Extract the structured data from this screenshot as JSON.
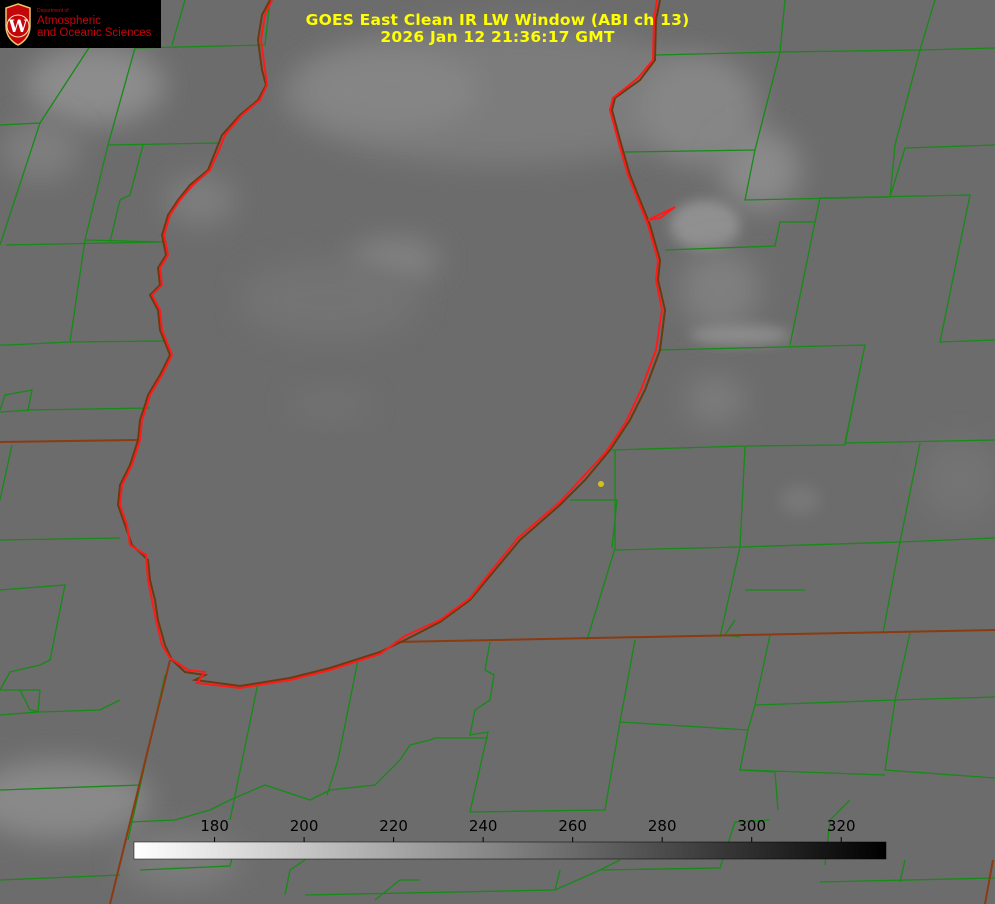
{
  "logo": {
    "department": "Department of",
    "line1": "Atmospheric",
    "line2": "and Oceanic Sciences",
    "crest_letter": "W",
    "brand_color": "#c5050c"
  },
  "title": {
    "line1": "GOES East Clean IR LW Window (ABI ch 13)",
    "line2": "2026 Jan 12 21:36:17 GMT",
    "color": "#ffff00"
  },
  "colorbar": {
    "min": 162,
    "max": 330,
    "ticks": [
      "180",
      "200",
      "220",
      "240",
      "260",
      "280",
      "300",
      "320"
    ],
    "tick_values": [
      180,
      200,
      220,
      240,
      260,
      280,
      300,
      320
    ],
    "scale": "white-to-black"
  },
  "colors": {
    "county_lines": "#178a17",
    "coastline": "#ff1a1a",
    "state_lines": "#8a3a10",
    "marker": "#d4c21a"
  }
}
